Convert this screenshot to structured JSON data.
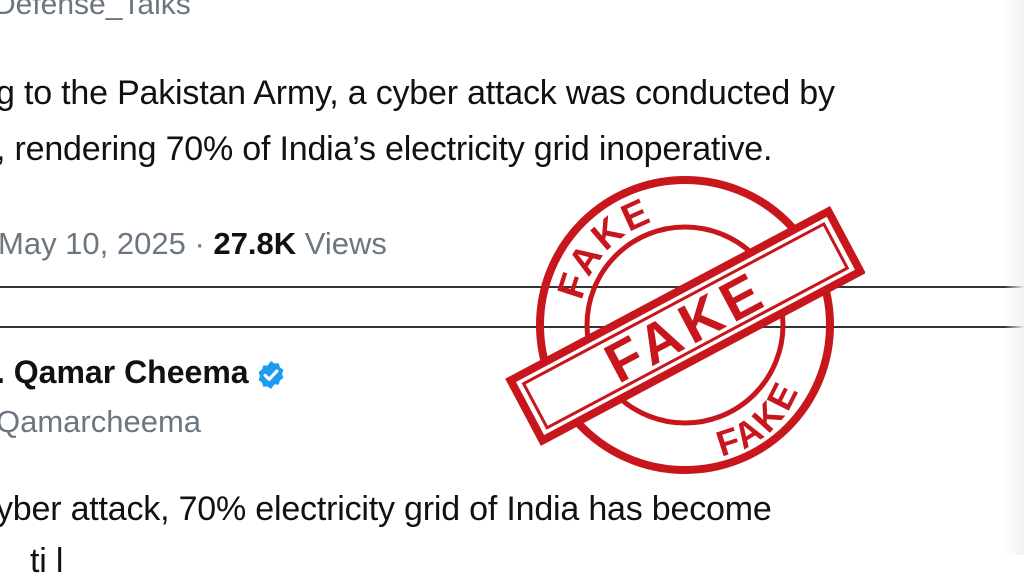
{
  "tweet1": {
    "handle": "Defense_Talks",
    "line1": "g to the Pakistan Army, a cyber attack was conducted by",
    "line2": ", rendering 70% of India’s electricity grid inoperative.",
    "date": "May 10, 2025",
    "separator": " · ",
    "views_count": "27.8K",
    "views_label": " Views"
  },
  "tweet2": {
    "name": ". Qamar Cheema",
    "handle": "Qamarcheema",
    "line1": "yber attack, 70% electricity grid of India has become",
    "line2": "ti        l"
  },
  "stamp": {
    "top_word": "FAKE",
    "center_word": "FAKE",
    "bottom_word": "FAKE",
    "color": "#c8161d"
  },
  "colors": {
    "verified": "#1d9bf0",
    "muted": "#6b7680"
  }
}
